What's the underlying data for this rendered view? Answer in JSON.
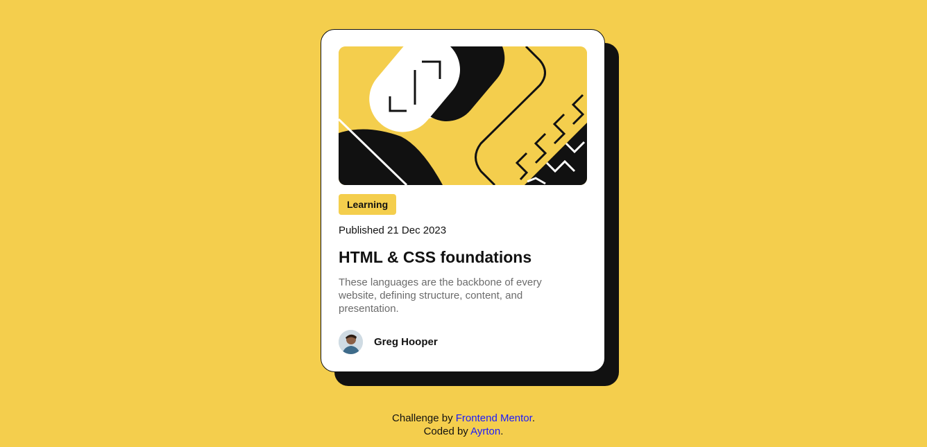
{
  "colors": {
    "background": "#F4CE4D",
    "accent": "#F4CE4D",
    "ink": "#111111",
    "muted_text": "#6B6B6B",
    "link": "#1A1AFF"
  },
  "card": {
    "hero_image": "illustration-article",
    "tag": "Learning",
    "published": "Published 21 Dec 2023",
    "title": "HTML & CSS foundations",
    "description": "These languages are the backbone of every website, defining structure, content, and presentation.",
    "author": {
      "avatar": "image-avatar",
      "name": "Greg Hooper"
    }
  },
  "attribution": {
    "line1_prefix": "Challenge by ",
    "line1_link": "Frontend Mentor",
    "line1_suffix": ".",
    "line2_prefix": "Coded by ",
    "line2_link": "Ayrton",
    "line2_suffix": "."
  }
}
